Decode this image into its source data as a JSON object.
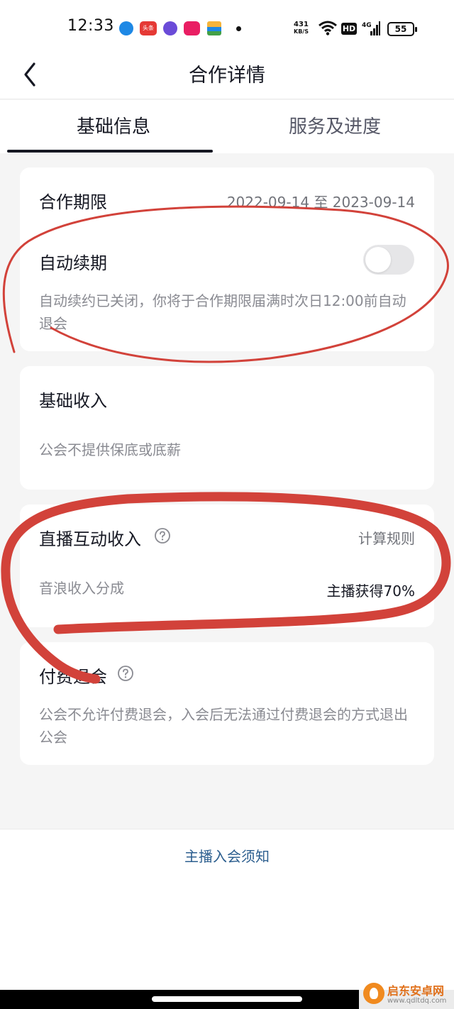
{
  "status_bar": {
    "time": "12:33",
    "headline_app_label": "头条",
    "net_speed_value": "431",
    "net_speed_unit": "KB/S",
    "hd_label": "HD",
    "network_type": "4G",
    "battery_level": "55",
    "icons": [
      "app-icon",
      "toutiao-icon",
      "app-icon",
      "video-app-icon",
      "wallet-app-icon",
      "wifi-icon",
      "signal-icon",
      "battery-icon"
    ]
  },
  "nav": {
    "title": "合作详情",
    "back_icon": "chevron-left-icon"
  },
  "tabs": [
    {
      "label": "基础信息",
      "active": true
    },
    {
      "label": "服务及进度",
      "active": false
    }
  ],
  "cooperation": {
    "period_label": "合作期限",
    "period_value": "2022-09-14 至 2023-09-14",
    "auto_renew_label": "自动续期",
    "auto_renew_on": false,
    "auto_renew_desc": "自动续约已关闭，你将于合作期限届满时次日12:00前自动退会"
  },
  "base_income": {
    "title": "基础收入",
    "desc": "公会不提供保底或底薪"
  },
  "live_income": {
    "title": "直播互动收入",
    "rule_link": "计算规则",
    "share_label": "音浪收入分成",
    "share_value": "主播获得70%"
  },
  "paid_exit": {
    "title": "付费退会",
    "desc": "公会不允许付费退会，入会后无法通过付费退会的方式退出公会"
  },
  "footer": {
    "link": "主播入会须知"
  },
  "watermark": {
    "title": "启东安卓网",
    "url": "www.qdltdq.com"
  },
  "colors": {
    "accent_text": "#161823",
    "secondary_text": "#8a8b92",
    "link": "#2d5f8f",
    "annotation_red": "#d2423a"
  }
}
